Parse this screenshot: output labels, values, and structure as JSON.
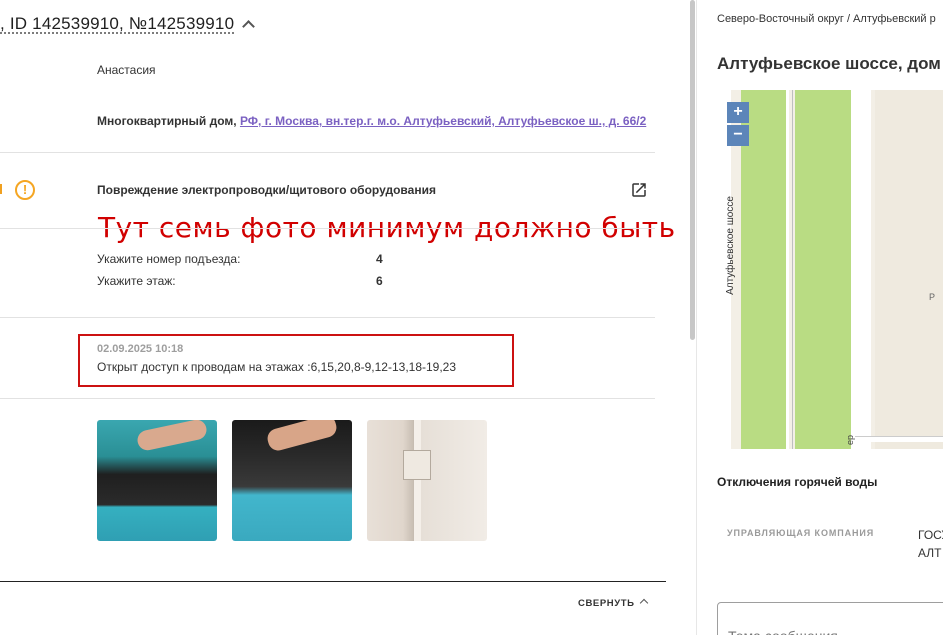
{
  "ticket": {
    "title": ", ID 142539910, №142539910",
    "author": "Анастасия",
    "address_prefix": "Многоквартирный дом, ",
    "address_link": "РФ, г. Москва, вн.тер.г. м.о. Алтуфьевский, Алтуфьевское ш., д. 66/2",
    "problem": "Повреждение электропроводки/щитового оборудования",
    "annotation": "Тут семь фото минимум должно быть",
    "fields": [
      {
        "label": "Укажите номер подъезда:",
        "value": "4"
      },
      {
        "label": "Укажите этаж:",
        "value": "6"
      }
    ],
    "comment": {
      "date": "02.09.2025 10:18",
      "text": "Открыт доступ к проводам на этажах :6,15,20,8-9,12-13,18-19,23"
    },
    "photos": [
      "photo-1",
      "photo-2",
      "photo-3"
    ],
    "collapse_label": "СВЕРНУТЬ",
    "colors": {
      "annotation": "#d10000",
      "link": "#7b61c2",
      "warning": "#f5a623",
      "highlight_box": "#cc1111"
    }
  },
  "sidebar": {
    "breadcrumb": "Северо-Восточный округ / Алтуфьевский р",
    "street_title": "Алтуфьевское шоссе, дом",
    "map": {
      "street_label": "Алтуфьевское шоссе",
      "parking_label": "P",
      "lane_label": "ер",
      "zoom_in": "+",
      "zoom_out": "−"
    },
    "outage_title": "Отключения горячей воды",
    "company_label": "УПРАВЛЯЮЩАЯ КОМПАНИЯ",
    "company_value_line1": "ГОСУ",
    "company_value_line2": "АЛТ",
    "topic_placeholder": "Тема сообщения"
  }
}
